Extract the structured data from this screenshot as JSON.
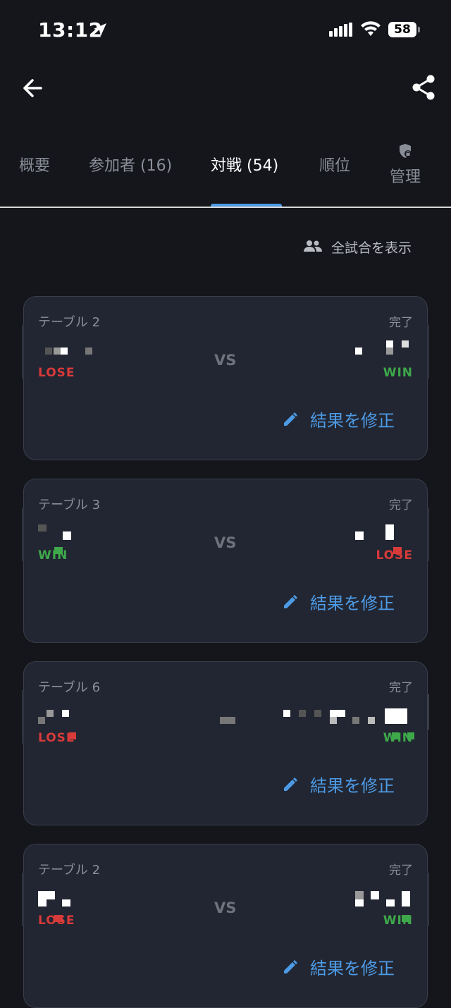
{
  "status_bar": {
    "time": "13:12",
    "battery": "58"
  },
  "tabs": [
    {
      "label": "概要"
    },
    {
      "label": "参加者 (16)"
    },
    {
      "label": "対戦 (54)"
    },
    {
      "label": "順位"
    },
    {
      "label": "管理"
    }
  ],
  "show_all_label": "全試合を表示",
  "vs_label": "VS",
  "edit_label": "結果を修正",
  "matches": [
    {
      "table": "テーブル 2",
      "status": "完了",
      "left_result": "LOSE",
      "right_result": "WIN"
    },
    {
      "table": "テーブル 3",
      "status": "完了",
      "left_result": "WIN",
      "right_result": "LOSE"
    },
    {
      "table": "テーブル 6",
      "status": "完了",
      "left_result": "LOSE",
      "right_result": "WIN"
    },
    {
      "table": "テーブル 2",
      "status": "完了",
      "left_result": "LOSE",
      "right_result": "WIN"
    }
  ],
  "colors": {
    "accent": "#4d9be6",
    "win": "#3ea84a",
    "lose": "#d83a3a",
    "card": "#222632",
    "background": "#14161c"
  },
  "icons": [
    "location-arrow-icon",
    "signal-icon",
    "wifi-icon",
    "back-arrow-icon",
    "share-icon",
    "shield-lock-icon",
    "people-icon",
    "pencil-icon"
  ]
}
